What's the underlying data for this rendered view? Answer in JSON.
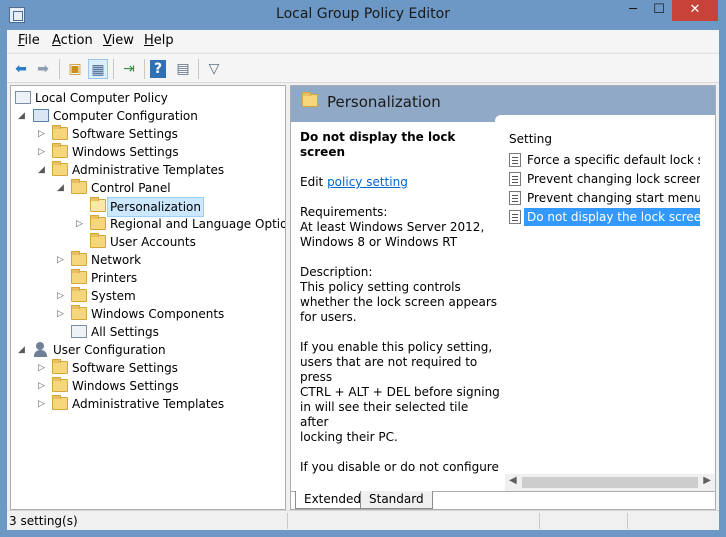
{
  "window": {
    "title": "Local Group Policy Editor",
    "minimize_glyph": "─",
    "maximize_glyph": "☐",
    "close_glyph": "✕"
  },
  "menu": [
    {
      "label": "File",
      "accel": "F",
      "rest": "ile"
    },
    {
      "label": "Action",
      "accel": "A",
      "rest": "ction"
    },
    {
      "label": "View",
      "accel": "V",
      "rest": "iew"
    },
    {
      "label": "Help",
      "accel": "H",
      "rest": "elp"
    }
  ],
  "toolbar": {
    "icons": [
      "back-arrow-icon",
      "forward-arrow-icon",
      "up-folder-icon",
      "show-hide-tree-icon",
      "export-list-icon",
      "help-icon",
      "properties-icon",
      "filter-icon"
    ]
  },
  "tree": {
    "items": [
      {
        "label": "Local Computer Policy",
        "icon": "policy-doc-icon"
      },
      {
        "label": "Computer Configuration",
        "icon": "computer-icon"
      },
      {
        "label": "Software Settings",
        "icon": "folder-icon"
      },
      {
        "label": "Windows Settings",
        "icon": "folder-icon"
      },
      {
        "label": "Administrative Templates",
        "icon": "folder-icon"
      },
      {
        "label": "Control Panel",
        "icon": "folder-icon"
      },
      {
        "label": "Personalization",
        "icon": "folder-open-icon"
      },
      {
        "label": "Regional and Language Options",
        "icon": "folder-icon"
      },
      {
        "label": "User Accounts",
        "icon": "folder-icon"
      },
      {
        "label": "Network",
        "icon": "folder-icon"
      },
      {
        "label": "Printers",
        "icon": "folder-icon"
      },
      {
        "label": "System",
        "icon": "folder-icon"
      },
      {
        "label": "Windows Components",
        "icon": "folder-icon"
      },
      {
        "label": "All Settings",
        "icon": "settings-doc-icon"
      },
      {
        "label": "User Configuration",
        "icon": "user-icon"
      },
      {
        "label": "Software Settings",
        "icon": "folder-icon"
      },
      {
        "label": "Windows Settings",
        "icon": "folder-icon"
      },
      {
        "label": "Administrative Templates",
        "icon": "folder-icon"
      }
    ],
    "selected": "Personalization"
  },
  "right_pane": {
    "header": "Personalization",
    "description": {
      "title": "Do not display the lock screen",
      "edit_prefix": "Edit ",
      "edit_link": "policy setting",
      "requirements_label": "Requirements:",
      "requirements_line1": "At least Windows Server 2012,",
      "requirements_line2": "Windows 8 or Windows RT",
      "description_label": "Description:",
      "description_line1": "This policy setting controls",
      "description_line2": "whether the lock screen appears",
      "description_line3": "for users.",
      "enable_line1": "If you enable this policy setting,",
      "enable_line2": "users that are not required to press",
      "enable_line3": "CTRL + ALT + DEL before signing",
      "enable_line4": "in will see their selected tile after",
      "enable_line5": "locking their PC.",
      "disable_line1": "If you disable or do not configure"
    },
    "settings_header": "Setting",
    "settings": [
      "Force a specific default lock sc...",
      "Prevent changing lock screen i...",
      "Prevent changing start menu ...",
      "Do not display the lock screen"
    ],
    "selected_setting": "Do not display the lock screen",
    "tabs": [
      "Extended",
      "Standard"
    ],
    "active_tab": "Extended"
  },
  "status": {
    "text": "3 setting(s)"
  },
  "colors": {
    "title_bar": "#6d98c6",
    "pane_header": "#8fa9c7",
    "selection": "#3399ff",
    "tree_selection": "#cce8ff",
    "link": "#0066cc"
  }
}
